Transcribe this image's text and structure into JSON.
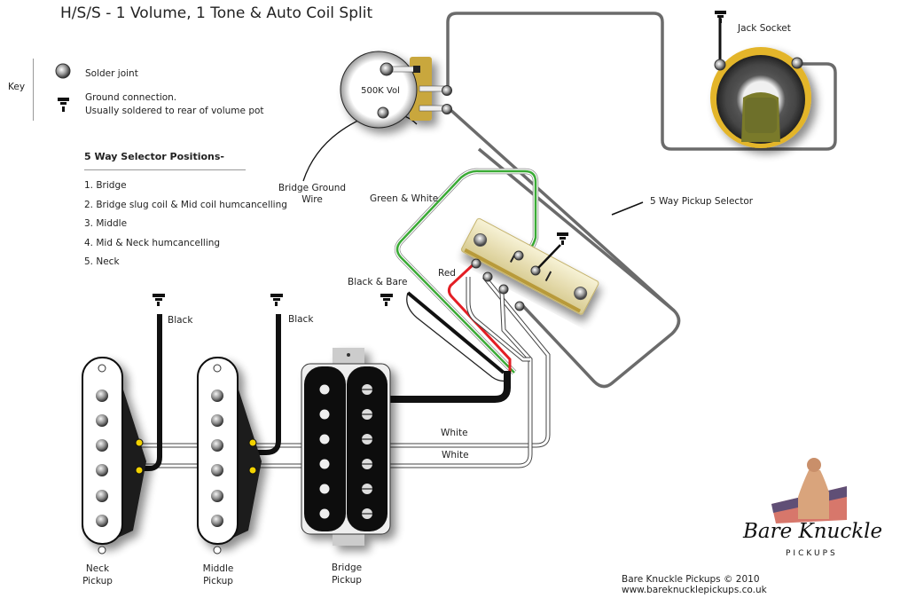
{
  "title": "H/S/S - 1 Volume, 1 Tone & Auto Coil Split",
  "key": {
    "label": "Key",
    "items": [
      {
        "icon": "solder-joint-icon",
        "text": "Solder joint"
      },
      {
        "icon": "ground-icon",
        "text_line1": "Ground connection.",
        "text_line2": "Usually soldered to rear of volume pot"
      }
    ]
  },
  "selector_positions": {
    "heading": "5 Way Selector Positions-",
    "items": [
      "1. Bridge",
      "2. Bridge slug coil & Mid coil humcancelling",
      "3. Middle",
      "4. Mid & Neck humcancelling",
      "5. Neck"
    ]
  },
  "components": {
    "volume_pot": "500K Vol",
    "jack_socket": "Jack Socket",
    "pickup_selector": "5 Way Pickup Selector",
    "neck_pickup_line1": "Neck",
    "neck_pickup_line2": "Pickup",
    "middle_pickup_line1": "Middle",
    "middle_pickup_line2": "Pickup",
    "bridge_pickup_line1": "Bridge",
    "bridge_pickup_line2": "Pickup"
  },
  "wire_labels": {
    "bridge_ground_line1": "Bridge Ground",
    "bridge_ground_line2": "Wire",
    "green_white": "Green & White",
    "red": "Red",
    "black_bare": "Black & Bare",
    "neck_black": "Black",
    "middle_black": "Black",
    "white_upper": "White",
    "white_lower": "White"
  },
  "colors": {
    "wire_gray": "#6b6b6b",
    "wire_green": "#3aaa35",
    "wire_red": "#e31e24",
    "wire_black": "#111111",
    "pot_lug_gold": "#c9a73c",
    "jack_gold": "#e3b52c",
    "selector_body": "#e8e0b4"
  },
  "branding": {
    "logo_text": "Bare Knuckle",
    "logo_sub": "PICKUPS",
    "footer_copyright": "Bare Knuckle Pickups © 2010",
    "footer_url": "www.bareknucklepickups.co.uk"
  }
}
